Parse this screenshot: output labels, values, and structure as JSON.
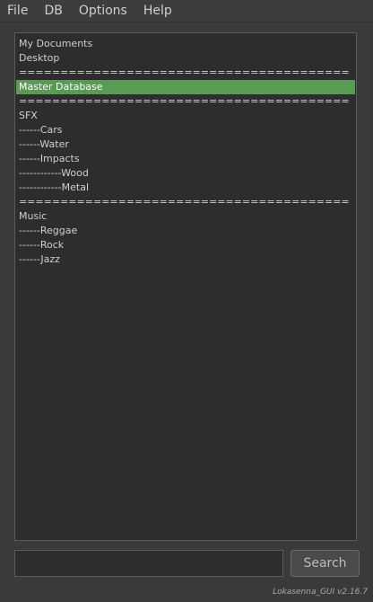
{
  "menu": {
    "items": [
      {
        "label": "File"
      },
      {
        "label": "DB"
      },
      {
        "label": "Options"
      },
      {
        "label": "Help"
      }
    ]
  },
  "list": {
    "items": [
      {
        "label": "My Documents",
        "selected": false
      },
      {
        "label": "Desktop",
        "selected": false
      },
      {
        "label": "========================================",
        "selected": false
      },
      {
        "label": "Master Database",
        "selected": true
      },
      {
        "label": "========================================",
        "selected": false
      },
      {
        "label": "SFX",
        "selected": false
      },
      {
        "label": "------Cars",
        "selected": false
      },
      {
        "label": "------Water",
        "selected": false
      },
      {
        "label": "------Impacts",
        "selected": false
      },
      {
        "label": "------------Wood",
        "selected": false
      },
      {
        "label": "------------Metal",
        "selected": false
      },
      {
        "label": "========================================",
        "selected": false
      },
      {
        "label": "Music",
        "selected": false
      },
      {
        "label": "------Reggae",
        "selected": false
      },
      {
        "label": "------Rock",
        "selected": false
      },
      {
        "label": "------Jazz",
        "selected": false
      }
    ]
  },
  "search": {
    "value": "",
    "placeholder": "",
    "button_label": "Search"
  },
  "footer": {
    "version": "Lokasenna_GUI v2.16.7"
  },
  "colors": {
    "selection": "#5a9a54",
    "background": "#3a3a3a",
    "panel": "#2d2d2d"
  }
}
